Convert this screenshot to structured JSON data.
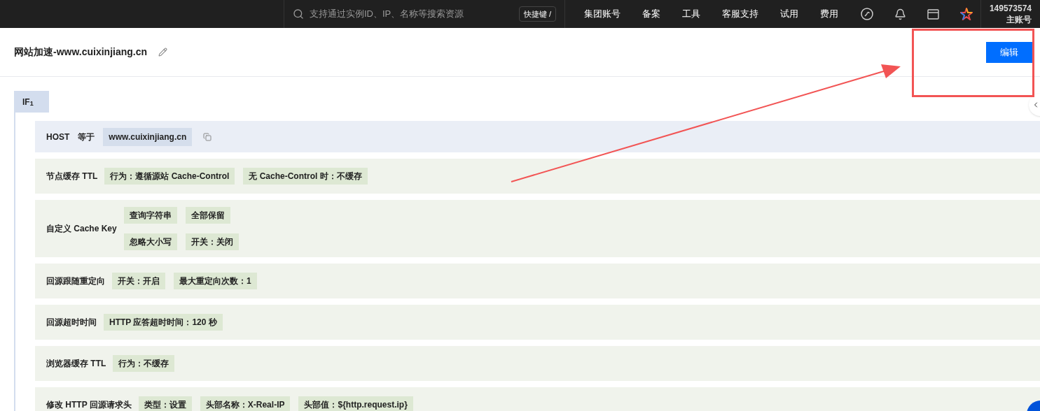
{
  "top_bar": {
    "search": {
      "placeholder": "支持通过实例ID、IP、名称等搜索资源"
    },
    "shortcut": "快捷键 /",
    "nav": [
      "集团账号",
      "备案",
      "工具",
      "客服支持",
      "试用",
      "费用"
    ],
    "account": {
      "id": "149573574",
      "role": "主账号"
    }
  },
  "header": {
    "title": "网站加速-www.cuixinjiang.cn",
    "edit_button": "编辑"
  },
  "condition": {
    "label": "IF$_{1}$",
    "field": "HOST",
    "operator": "等于",
    "value": "www.cuixinjiang.cn"
  },
  "rules": [
    {
      "name": "节点缓存 TTL",
      "tag_rows": [
        [
          "行为：遵循源站 Cache-Control",
          "无 Cache-Control 时：不缓存"
        ]
      ]
    },
    {
      "name": "自定义 Cache Key",
      "tag_rows": [
        [
          "查询字符串",
          "全部保留"
        ],
        [
          "忽略大小写",
          "开关：关闭"
        ]
      ]
    },
    {
      "name": "回源跟随重定向",
      "tag_rows": [
        [
          "开关：开启",
          "最大重定向次数：1"
        ]
      ]
    },
    {
      "name": "回源超时时间",
      "tag_rows": [
        [
          "HTTP 应答超时时间：120 秒"
        ]
      ]
    },
    {
      "name": "浏览器缓存 TTL",
      "tag_rows": [
        [
          "行为：不缓存"
        ]
      ]
    },
    {
      "name": "修改 HTTP 回源请求头",
      "tag_rows": [
        [
          "类型：设置",
          "头部名称：X-Real-IP",
          "头部值：${http.request.ip}"
        ]
      ]
    }
  ]
}
